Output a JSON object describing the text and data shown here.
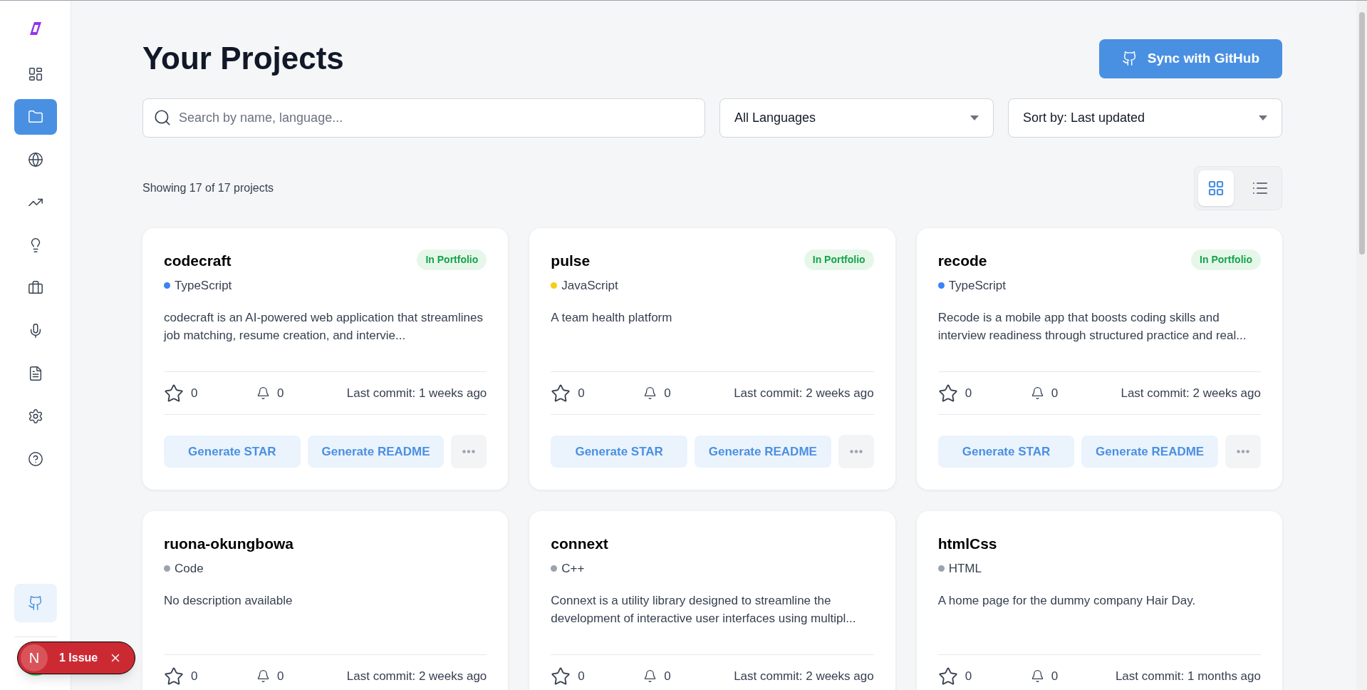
{
  "sidebar": {
    "items": [
      {
        "selected": false
      },
      {
        "selected": true
      },
      {
        "selected": false
      },
      {
        "selected": false
      },
      {
        "selected": false
      },
      {
        "selected": false
      },
      {
        "selected": false
      },
      {
        "selected": false
      },
      {
        "selected": false
      },
      {
        "selected": false
      }
    ],
    "github_button": {
      "selected": false
    }
  },
  "header": {
    "title": "Your Projects",
    "sync_button": "Sync with GitHub"
  },
  "filters": {
    "search": {
      "placeholder": "Search by name, language..."
    },
    "language": "All Languages",
    "sort": "Sort by: Last updated"
  },
  "summary": "Showing 17 of 17 projects",
  "view_toggle": [
    {
      "selected": true
    },
    {
      "selected": false
    }
  ],
  "projects": [
    {
      "name": "codecraft",
      "badge": "In Portfolio",
      "language": "TypeScript",
      "color": "#3b82f6",
      "description": "codecraft is an AI-powered web application that streamlines job matching, resume creation, and intervie...",
      "stars": "0",
      "watchers": "0",
      "last_commit": "Last commit: 1 weeks ago",
      "actions": [
        "Generate STAR",
        "Generate README"
      ]
    },
    {
      "name": "pulse",
      "badge": "In Portfolio",
      "language": "JavaScript",
      "color": "#facc15",
      "description": "A team health platform",
      "stars": "0",
      "watchers": "0",
      "last_commit": "Last commit: 2 weeks ago",
      "actions": [
        "Generate STAR",
        "Generate README"
      ]
    },
    {
      "name": "recode",
      "badge": "In Portfolio",
      "language": "TypeScript",
      "color": "#3b82f6",
      "description": "Recode is a mobile app that boosts coding skills and interview readiness through structured practice and real...",
      "stars": "0",
      "watchers": "0",
      "last_commit": "Last commit: 2 weeks ago",
      "actions": [
        "Generate STAR",
        "Generate README"
      ]
    },
    {
      "name": "ruona-okungbowa",
      "language": "Code",
      "color": "#9ca3af",
      "description": "No description available",
      "stars": "0",
      "watchers": "0",
      "last_commit": "Last commit: 2 weeks ago"
    },
    {
      "name": "connext",
      "language": "C++",
      "color": "#9ca3af",
      "description": "Connext is a utility library designed to streamline the development of interactive user interfaces using multipl...",
      "stars": "0",
      "watchers": "0",
      "last_commit": "Last commit: 2 weeks ago"
    },
    {
      "name": "htmlCss",
      "language": "HTML",
      "color": "#9ca3af",
      "description": "A home page for the dummy company Hair Day.",
      "stars": "0",
      "watchers": "0",
      "last_commit": "Last commit: 1 months ago"
    }
  ],
  "issue_badge": {
    "initial": "N",
    "label": "1 Issue"
  }
}
